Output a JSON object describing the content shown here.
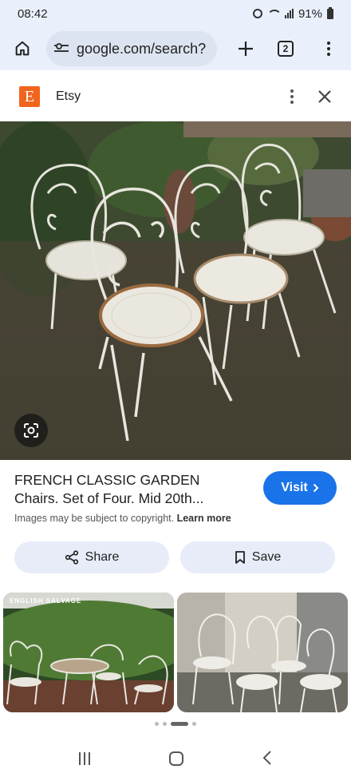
{
  "status_bar": {
    "time": "08:42",
    "battery": "91%"
  },
  "browser": {
    "url": "google.com/search?",
    "tab_count": "2"
  },
  "source": {
    "name": "Etsy",
    "logo_letter": "E"
  },
  "result": {
    "title_line1": "FRENCH CLASSIC GARDEN",
    "title_line2": "Chairs. Set of Four. Mid 20th...",
    "visit_label": "Visit",
    "copyright_text": "Images may be subject to copyright.",
    "learn_more": "Learn more",
    "share_label": "Share",
    "save_label": "Save"
  },
  "related": {
    "thumb1_badge": "ENGLISH SALVAGE"
  },
  "icons": {
    "home": "home-icon",
    "tune": "tune-icon",
    "plus": "new-tab-icon",
    "tabs": "tab-switcher-icon",
    "menu": "more-vert-icon",
    "close": "close-icon",
    "lens": "google-lens-icon",
    "share": "share-icon",
    "save": "bookmark-icon",
    "chevron": "chevron-right-icon"
  },
  "colors": {
    "accent": "#1a73e8",
    "etsy": "#f1641e",
    "chrome_bg": "#eaf0fb",
    "button_bg": "#e7ecf8"
  }
}
